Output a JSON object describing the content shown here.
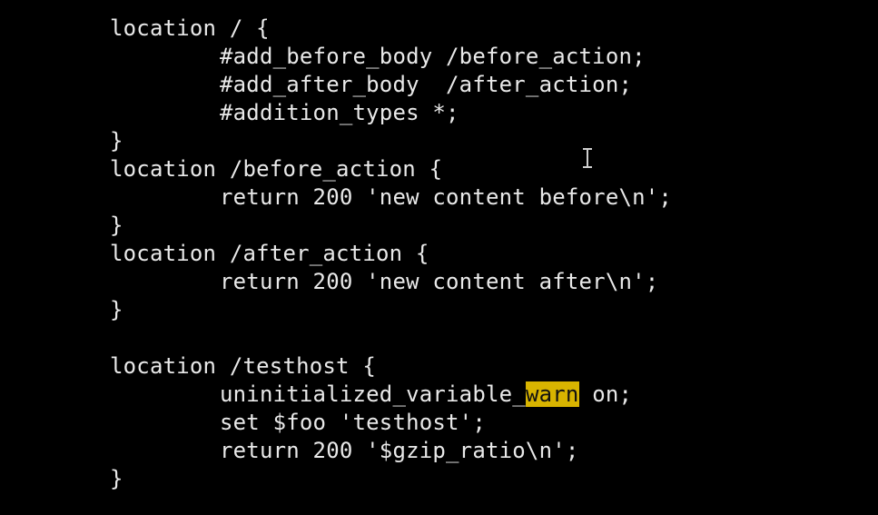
{
  "code_lines": [
    {
      "indent": false,
      "text": "location / {"
    },
    {
      "indent": true,
      "text": "#add_before_body /before_action;"
    },
    {
      "indent": true,
      "text": "#add_after_body  /after_action;"
    },
    {
      "indent": true,
      "text": "#addition_types *;"
    },
    {
      "indent": false,
      "text": "}"
    },
    {
      "indent": false,
      "text": "location /before_action {"
    },
    {
      "indent": true,
      "text": "return 200 'new content before\\n';"
    },
    {
      "indent": false,
      "text": "}"
    },
    {
      "indent": false,
      "text": "location /after_action {"
    },
    {
      "indent": true,
      "text": "return 200 'new content after\\n';"
    },
    {
      "indent": false,
      "text": "}"
    },
    {
      "indent": false,
      "text": ""
    },
    {
      "indent": false,
      "text": "location /testhost {"
    },
    {
      "indent": true,
      "text": "uninitialized_variable_",
      "highlight": "warn",
      "after": " on;"
    },
    {
      "indent": true,
      "text": "set $foo 'testhost';"
    },
    {
      "indent": true,
      "text": "return 200 '$gzip_ratio\\n';"
    },
    {
      "indent": false,
      "text": "}"
    }
  ],
  "colors": {
    "background": "#000000",
    "text": "#e9e9e9",
    "highlight_bg": "#d8b400",
    "highlight_text": "#111111",
    "cursor": "#cfcfcf"
  },
  "cursor_icon": "text-cursor-ibeam-icon"
}
